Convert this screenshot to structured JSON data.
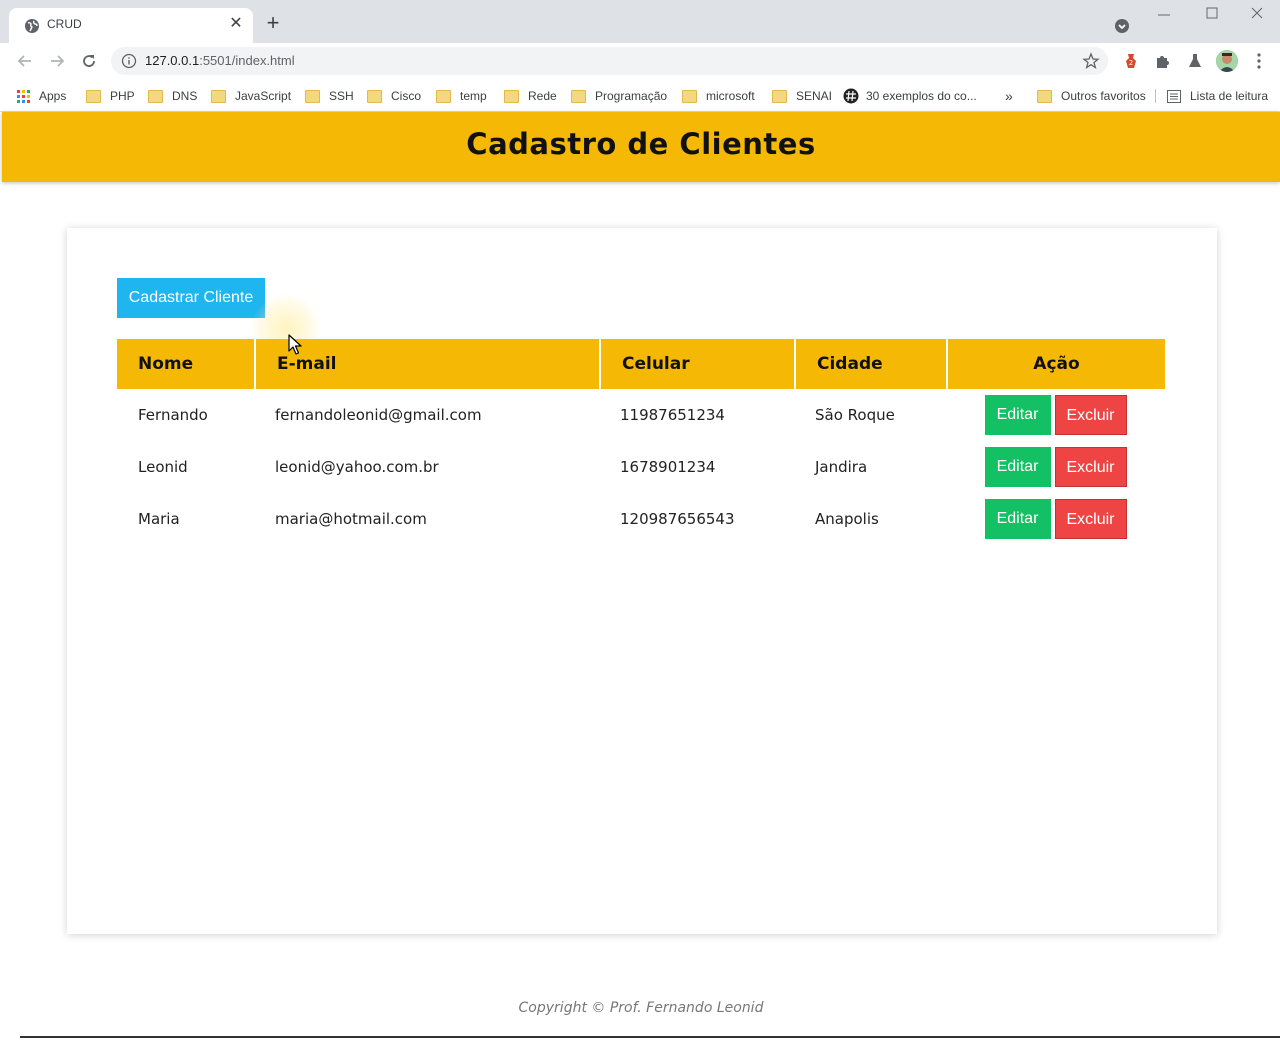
{
  "browser": {
    "tab_title": "CRUD",
    "url_host": "127.0.0.1",
    "url_rest": ":5501/index.html",
    "bookmarks": [
      {
        "label": "Apps",
        "icon": "apps-icon"
      },
      {
        "label": "PHP",
        "icon": "folder-icon"
      },
      {
        "label": "DNS",
        "icon": "folder-icon"
      },
      {
        "label": "JavaScript",
        "icon": "folder-icon"
      },
      {
        "label": "SSH",
        "icon": "folder-icon"
      },
      {
        "label": "Cisco",
        "icon": "folder-icon"
      },
      {
        "label": "temp",
        "icon": "folder-icon"
      },
      {
        "label": "Rede",
        "icon": "folder-icon"
      },
      {
        "label": "Programação",
        "icon": "folder-icon"
      },
      {
        "label": "microsoft",
        "icon": "folder-icon"
      },
      {
        "label": "SENAI",
        "icon": "folder-icon"
      },
      {
        "label": "30 exemplos do co...",
        "icon": "hash-site-icon"
      }
    ],
    "overflow_label": "»",
    "other_bookmarks": "Outros favoritos",
    "reading_list": "Lista de leitura"
  },
  "page": {
    "title": "Cadastro de Clientes",
    "register_button": "Cadastrar Cliente",
    "table": {
      "headers": [
        "Nome",
        "E-mail",
        "Celular",
        "Cidade",
        "Ação"
      ],
      "rows": [
        {
          "nome": "Fernando",
          "email": "fernandoleonid@gmail.com",
          "celular": "11987651234",
          "cidade": "São Roque"
        },
        {
          "nome": "Leonid",
          "email": "leonid@yahoo.com.br",
          "celular": "1678901234",
          "cidade": "Jandira"
        },
        {
          "nome": "Maria",
          "email": "maria@hotmail.com",
          "celular": "120987656543",
          "cidade": "Anapolis"
        }
      ],
      "edit_label": "Editar",
      "delete_label": "Excluir"
    },
    "footer": "Copyright © Prof. Fernando Leonid"
  },
  "colors": {
    "accent_yellow": "#f5b905",
    "register_blue": "#1fb5ef",
    "edit_green": "#14c064",
    "delete_red": "#ef4444"
  }
}
